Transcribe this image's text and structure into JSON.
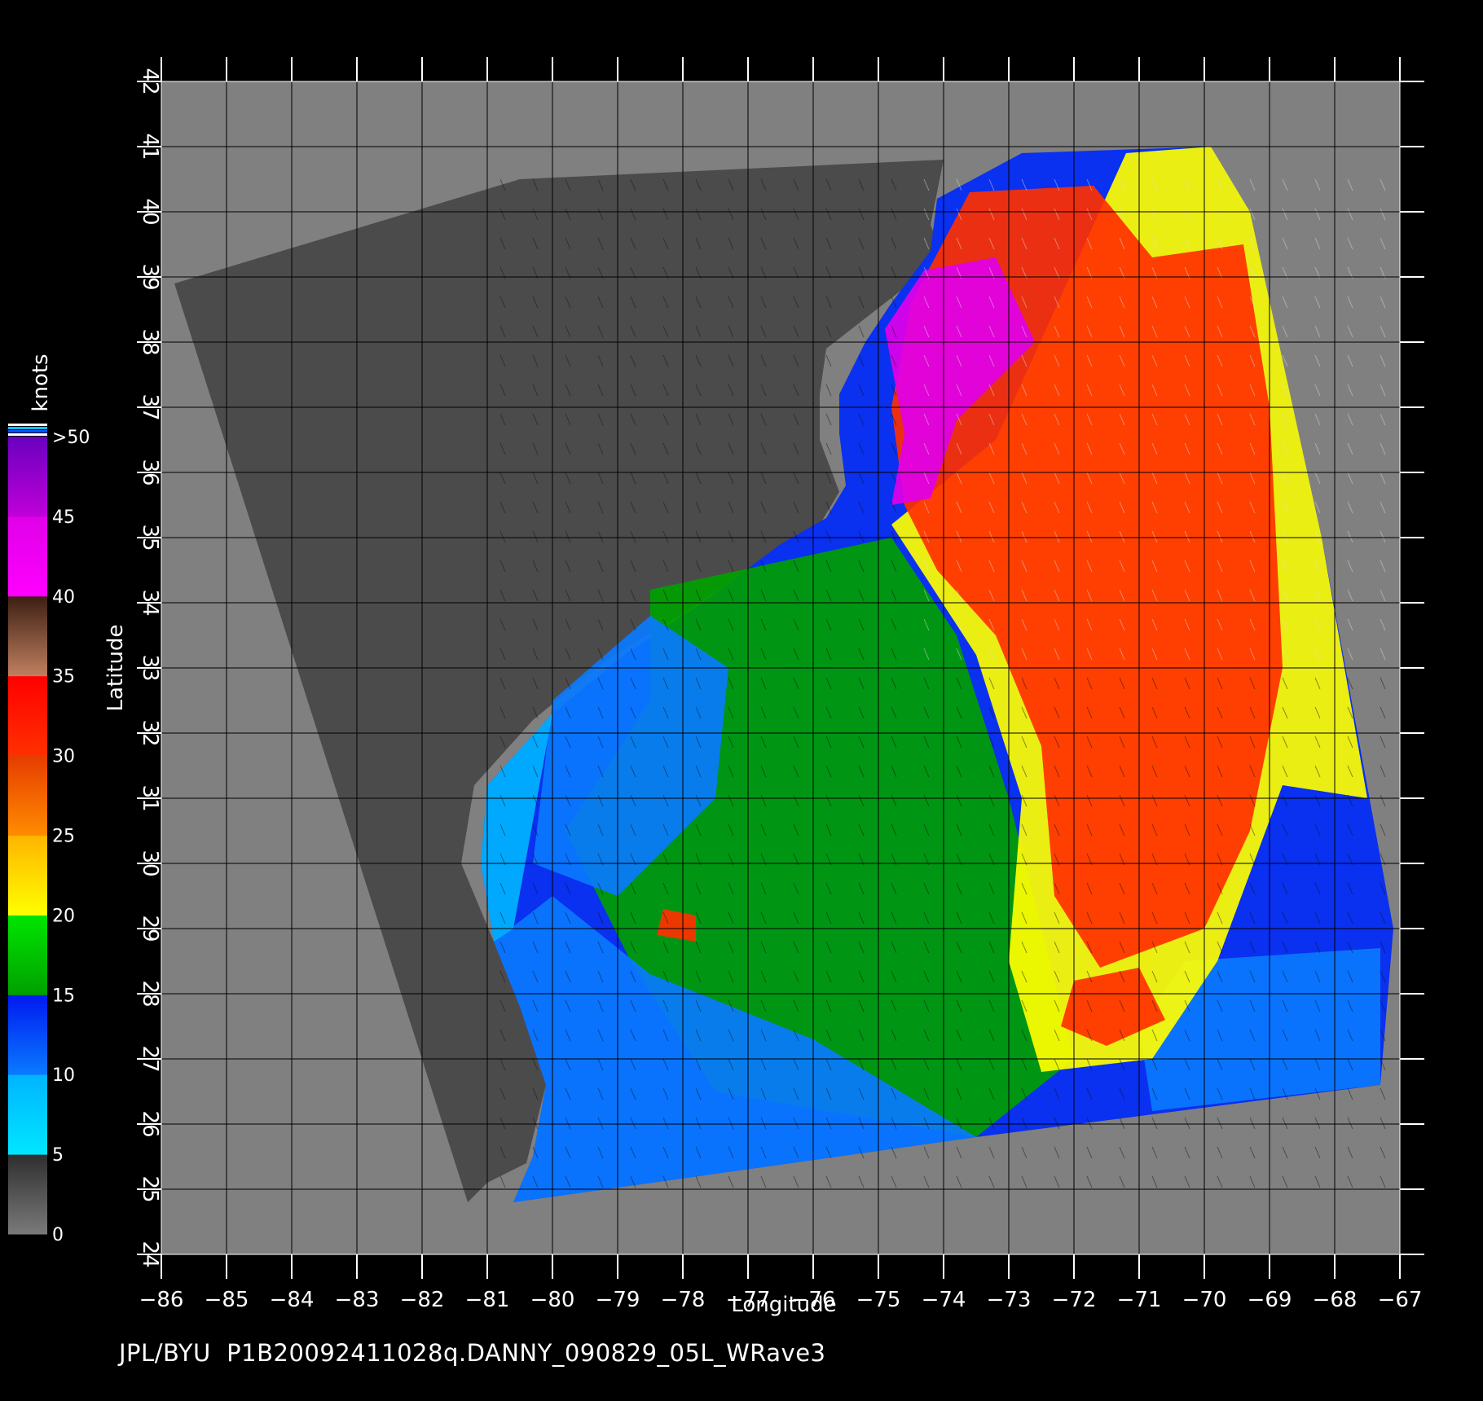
{
  "figure": {
    "xlabel": "Longitude",
    "ylabel": "Latitude",
    "footer": "JPL/BYU  P1B20092411028q.DANNY_090829_05L_WRave3",
    "x_ticks": [
      "−86",
      "−85",
      "−84",
      "−83",
      "−82",
      "−81",
      "−80",
      "−79",
      "−78",
      "−77",
      "−76",
      "−75",
      "−74",
      "−73",
      "−72",
      "−71",
      "−70",
      "−69",
      "−68",
      "−67"
    ],
    "y_ticks": [
      "24",
      "25",
      "26",
      "27",
      "28",
      "29",
      "30",
      "31",
      "32",
      "33",
      "34",
      "35",
      "36",
      "37",
      "38",
      "39",
      "40",
      "41",
      "42"
    ],
    "lon_range": [
      -86,
      -67
    ],
    "lat_range": [
      24,
      42
    ]
  },
  "legend": {
    "unit": "knots",
    "labels": [
      "0",
      "5",
      "10",
      "15",
      "20",
      "25",
      "30",
      "35",
      "40",
      "45",
      ">50"
    ],
    "bands": [
      {
        "from": 0,
        "to": 5,
        "colors": [
          "#7a7a7a",
          "#2e2e2e"
        ]
      },
      {
        "from": 5,
        "to": 10,
        "colors": [
          "#00e6ff",
          "#00b4ff"
        ]
      },
      {
        "from": 10,
        "to": 15,
        "colors": [
          "#0a7aff",
          "#0019f0"
        ]
      },
      {
        "from": 15,
        "to": 20,
        "colors": [
          "#00a000",
          "#00e600"
        ]
      },
      {
        "from": 20,
        "to": 25,
        "colors": [
          "#ffff00",
          "#ffb400"
        ]
      },
      {
        "from": 25,
        "to": 30,
        "colors": [
          "#ff8c00",
          "#e63c00"
        ]
      },
      {
        "from": 30,
        "to": 35,
        "colors": [
          "#ff3000",
          "#ff0000"
        ]
      },
      {
        "from": 35,
        "to": 40,
        "colors": [
          "#c08060",
          "#3c1e12"
        ]
      },
      {
        "from": 40,
        "to": 45,
        "colors": [
          "#ff00ff",
          "#e000e8"
        ]
      },
      {
        "from": 45,
        "to": 50,
        "colors": [
          "#c000d8",
          "#6a00c0"
        ]
      }
    ],
    "top_stripes": [
      "#ffffff",
      "#00c8ff",
      "#0050ff",
      "#ffffff"
    ]
  },
  "colors": {
    "background": "#000000",
    "no_data": "#808080",
    "land": "#4b4b4b",
    "grid": "#000000"
  },
  "map": {
    "land_polygon": [
      [
        -85.8,
        38.9
      ],
      [
        -80.5,
        40.5
      ],
      [
        -74.0,
        40.8
      ],
      [
        -74.2,
        39.8
      ],
      [
        -74.0,
        39.3
      ],
      [
        -74.9,
        38.6
      ],
      [
        -75.8,
        37.9
      ],
      [
        -75.9,
        37.2
      ],
      [
        -75.9,
        36.5
      ],
      [
        -75.6,
        35.7
      ],
      [
        -75.9,
        35.2
      ],
      [
        -76.6,
        34.8
      ],
      [
        -77.9,
        33.9
      ],
      [
        -79.2,
        33.1
      ],
      [
        -80.3,
        32.2
      ],
      [
        -81.2,
        31.2
      ],
      [
        -81.4,
        30.0
      ],
      [
        -80.9,
        28.8
      ],
      [
        -80.5,
        27.8
      ],
      [
        -80.1,
        26.6
      ],
      [
        -80.4,
        25.4
      ],
      [
        -81.0,
        25.1
      ],
      [
        -81.3,
        24.8
      ]
    ],
    "swath_polygon": [
      [
        -74.1,
        40.2
      ],
      [
        -72.8,
        40.9
      ],
      [
        -69.9,
        41.0
      ],
      [
        -69.3,
        40.0
      ],
      [
        -68.2,
        35.0
      ],
      [
        -67.1,
        29.0
      ],
      [
        -67.3,
        26.6
      ],
      [
        -73.5,
        25.8
      ],
      [
        -80.6,
        24.8
      ],
      [
        -80.3,
        25.5
      ],
      [
        -80.1,
        26.6
      ],
      [
        -80.5,
        27.8
      ],
      [
        -80.9,
        28.8
      ],
      [
        -81.1,
        30.0
      ],
      [
        -81.0,
        31.2
      ],
      [
        -80.0,
        32.3
      ],
      [
        -78.9,
        33.2
      ],
      [
        -77.7,
        34.0
      ],
      [
        -76.5,
        34.9
      ],
      [
        -75.8,
        35.3
      ],
      [
        -75.5,
        35.8
      ],
      [
        -75.6,
        36.6
      ],
      [
        -75.6,
        37.2
      ],
      [
        -75.2,
        38.0
      ],
      [
        -74.8,
        38.6
      ],
      [
        -74.2,
        39.4
      ]
    ],
    "wind_regions": [
      {
        "label": "green-band",
        "knots": 17,
        "points": [
          [
            -78.5,
            34.2
          ],
          [
            -74.8,
            35.0
          ],
          [
            -73.8,
            33.5
          ],
          [
            -73.0,
            31.0
          ],
          [
            -72.5,
            29.0
          ],
          [
            -72.0,
            27.0
          ],
          [
            -73.5,
            25.8
          ],
          [
            -77.5,
            26.5
          ],
          [
            -78.8,
            28.5
          ],
          [
            -79.8,
            30.5
          ],
          [
            -78.5,
            32.5
          ]
        ]
      },
      {
        "label": "blue-south",
        "knots": 12,
        "points": [
          [
            -80.6,
            24.8
          ],
          [
            -73.5,
            25.8
          ],
          [
            -76.0,
            27.3
          ],
          [
            -78.5,
            28.3
          ],
          [
            -80.0,
            29.5
          ],
          [
            -80.9,
            28.8
          ],
          [
            -80.5,
            27.8
          ],
          [
            -80.1,
            26.6
          ],
          [
            -80.3,
            25.5
          ]
        ]
      },
      {
        "label": "blue-central",
        "knots": 12,
        "points": [
          [
            -80.0,
            32.5
          ],
          [
            -78.5,
            33.8
          ],
          [
            -77.3,
            33.0
          ],
          [
            -77.5,
            31.0
          ],
          [
            -79.0,
            29.5
          ],
          [
            -80.3,
            30.0
          ]
        ]
      },
      {
        "label": "blue-east",
        "knots": 12,
        "points": [
          [
            -70.3,
            28.5
          ],
          [
            -67.3,
            28.7
          ],
          [
            -67.3,
            26.6
          ],
          [
            -70.8,
            26.2
          ],
          [
            -71.0,
            27.5
          ]
        ]
      },
      {
        "label": "yellow-band",
        "knots": 22,
        "points": [
          [
            -74.8,
            35.2
          ],
          [
            -73.2,
            36.5
          ],
          [
            -71.2,
            40.9
          ],
          [
            -69.9,
            41.0
          ],
          [
            -69.3,
            40.0
          ],
          [
            -68.2,
            35.0
          ],
          [
            -67.5,
            31.0
          ],
          [
            -68.8,
            31.2
          ],
          [
            -69.8,
            28.5
          ],
          [
            -70.8,
            27.0
          ],
          [
            -72.5,
            26.8
          ],
          [
            -73.0,
            28.5
          ],
          [
            -72.8,
            31.0
          ],
          [
            -73.5,
            33.2
          ]
        ]
      },
      {
        "label": "red-core",
        "knots": 32,
        "points": [
          [
            -74.5,
            38.6
          ],
          [
            -73.6,
            40.3
          ],
          [
            -71.7,
            40.4
          ],
          [
            -70.8,
            39.3
          ],
          [
            -69.4,
            39.5
          ],
          [
            -69.0,
            37.0
          ],
          [
            -68.8,
            33.0
          ],
          [
            -69.3,
            30.5
          ],
          [
            -70.0,
            29.0
          ],
          [
            -71.6,
            28.4
          ],
          [
            -72.3,
            29.5
          ],
          [
            -72.5,
            31.8
          ],
          [
            -73.2,
            33.5
          ],
          [
            -74.1,
            34.5
          ],
          [
            -74.6,
            35.5
          ],
          [
            -74.8,
            37.0
          ]
        ]
      },
      {
        "label": "purple-north",
        "knots": 43,
        "points": [
          [
            -74.9,
            38.2
          ],
          [
            -74.3,
            39.1
          ],
          [
            -73.2,
            39.3
          ],
          [
            -72.6,
            38.0
          ],
          [
            -73.8,
            36.8
          ],
          [
            -74.2,
            35.6
          ],
          [
            -74.8,
            35.5
          ],
          [
            -74.6,
            36.6
          ]
        ]
      },
      {
        "label": "cyan-coast",
        "knots": 8,
        "points": [
          [
            -81.0,
            31.2
          ],
          [
            -80.0,
            32.3
          ],
          [
            -80.6,
            29.0
          ],
          [
            -80.9,
            28.8
          ],
          [
            -81.1,
            30.0
          ]
        ]
      },
      {
        "label": "red-patch-1",
        "knots": 31,
        "points": [
          [
            -78.3,
            29.3
          ],
          [
            -77.8,
            29.2
          ],
          [
            -77.8,
            28.8
          ],
          [
            -78.4,
            28.9
          ]
        ]
      },
      {
        "label": "red-patch-2",
        "knots": 31,
        "points": [
          [
            -72.0,
            28.2
          ],
          [
            -71.0,
            28.4
          ],
          [
            -70.6,
            27.6
          ],
          [
            -71.5,
            27.2
          ],
          [
            -72.2,
            27.5
          ]
        ]
      }
    ]
  }
}
